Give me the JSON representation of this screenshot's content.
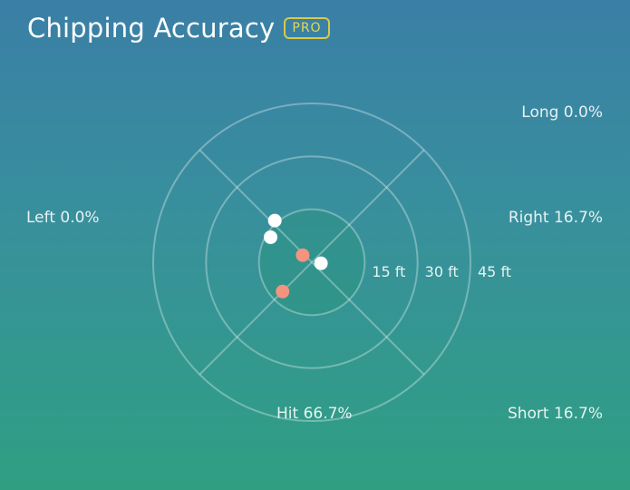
{
  "header": {
    "title": "Chipping Accuracy",
    "badge": "PRO"
  },
  "stats": {
    "long": "Long 0.0%",
    "right": "Right 16.7%",
    "left": "Left 0.0%",
    "short": "Short 16.7%",
    "hit": "Hit 66.7%"
  },
  "rings": [
    {
      "label": "15 ft",
      "radius_ft": 15
    },
    {
      "label": "30 ft",
      "radius_ft": 30
    },
    {
      "label": "45 ft",
      "radius_ft": 45
    }
  ],
  "colors": {
    "miss_shot": "#ffffff",
    "hit_shot": "#f4937f",
    "badge": "#d9c94a"
  },
  "shots": [
    {
      "type": "miss",
      "dx_ft": -10.5,
      "dy_ft": 11.8
    },
    {
      "type": "miss",
      "dx_ft": -11.7,
      "dy_ft": 7.1
    },
    {
      "type": "miss",
      "dx_ft": 2.6,
      "dy_ft": -0.3
    },
    {
      "type": "hit",
      "dx_ft": -2.6,
      "dy_ft": 2.0
    },
    {
      "type": "hit",
      "dx_ft": -8.3,
      "dy_ft": -8.3
    }
  ]
}
